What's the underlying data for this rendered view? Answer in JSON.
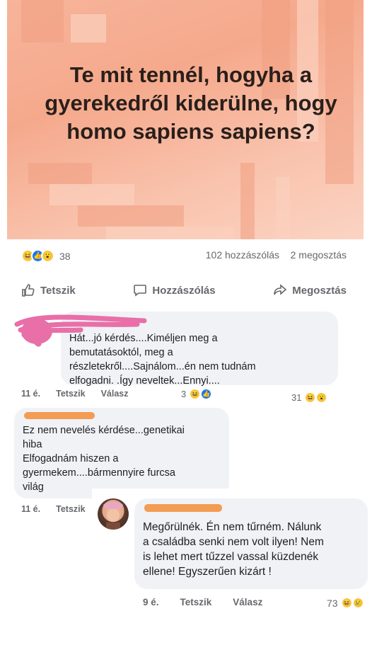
{
  "post": {
    "image_text": "Te mit tennél, hogyha a gyerekedről kiderülne, hogy homo sapiens sapiens?",
    "reaction_count": "38",
    "comments_count": "102 hozzászólás",
    "shares_count": "2 megosztás"
  },
  "actions": {
    "like": "Tetszik",
    "comment": "Hozzászólás",
    "share": "Megosztás"
  },
  "comments": [
    {
      "text_lines": [
        "Hát...jó kérdés....Kiméljen meg a",
        "bemutatásoktól, meg a",
        "részletekről....Sajnálom...én nem tudnám",
        "elfogadni. .Így neveltek...Ennyi...."
      ],
      "time": "11 é.",
      "like": "Tetszik",
      "reply": "Válasz",
      "inline_reacts": "3",
      "reacts_count": "31"
    },
    {
      "text_lines": [
        "Ez nem nevelés kérdése...genetikai",
        "hiba",
        "Elfogadnám hiszen a",
        "gyermekem....bármennyire furcsa",
        "világ"
      ],
      "time": "11 é.",
      "like": "Tetszik"
    },
    {
      "text_lines": [
        "Megőrülnék. Én nem tűrném. Nálunk",
        "a családba senki nem volt ilyen! Nem",
        "is lehet mert tűzzel vassal küzdenék",
        "ellene! Egyszerűen kizárt !"
      ],
      "time": "9 é.",
      "like": "Tetszik",
      "reply": "Válasz",
      "reacts_count": "73"
    }
  ],
  "colors": {
    "accent_orange": "#f39c54",
    "scribble_pink": "#e86fa8",
    "bubble_bg": "#f0f2f5"
  }
}
